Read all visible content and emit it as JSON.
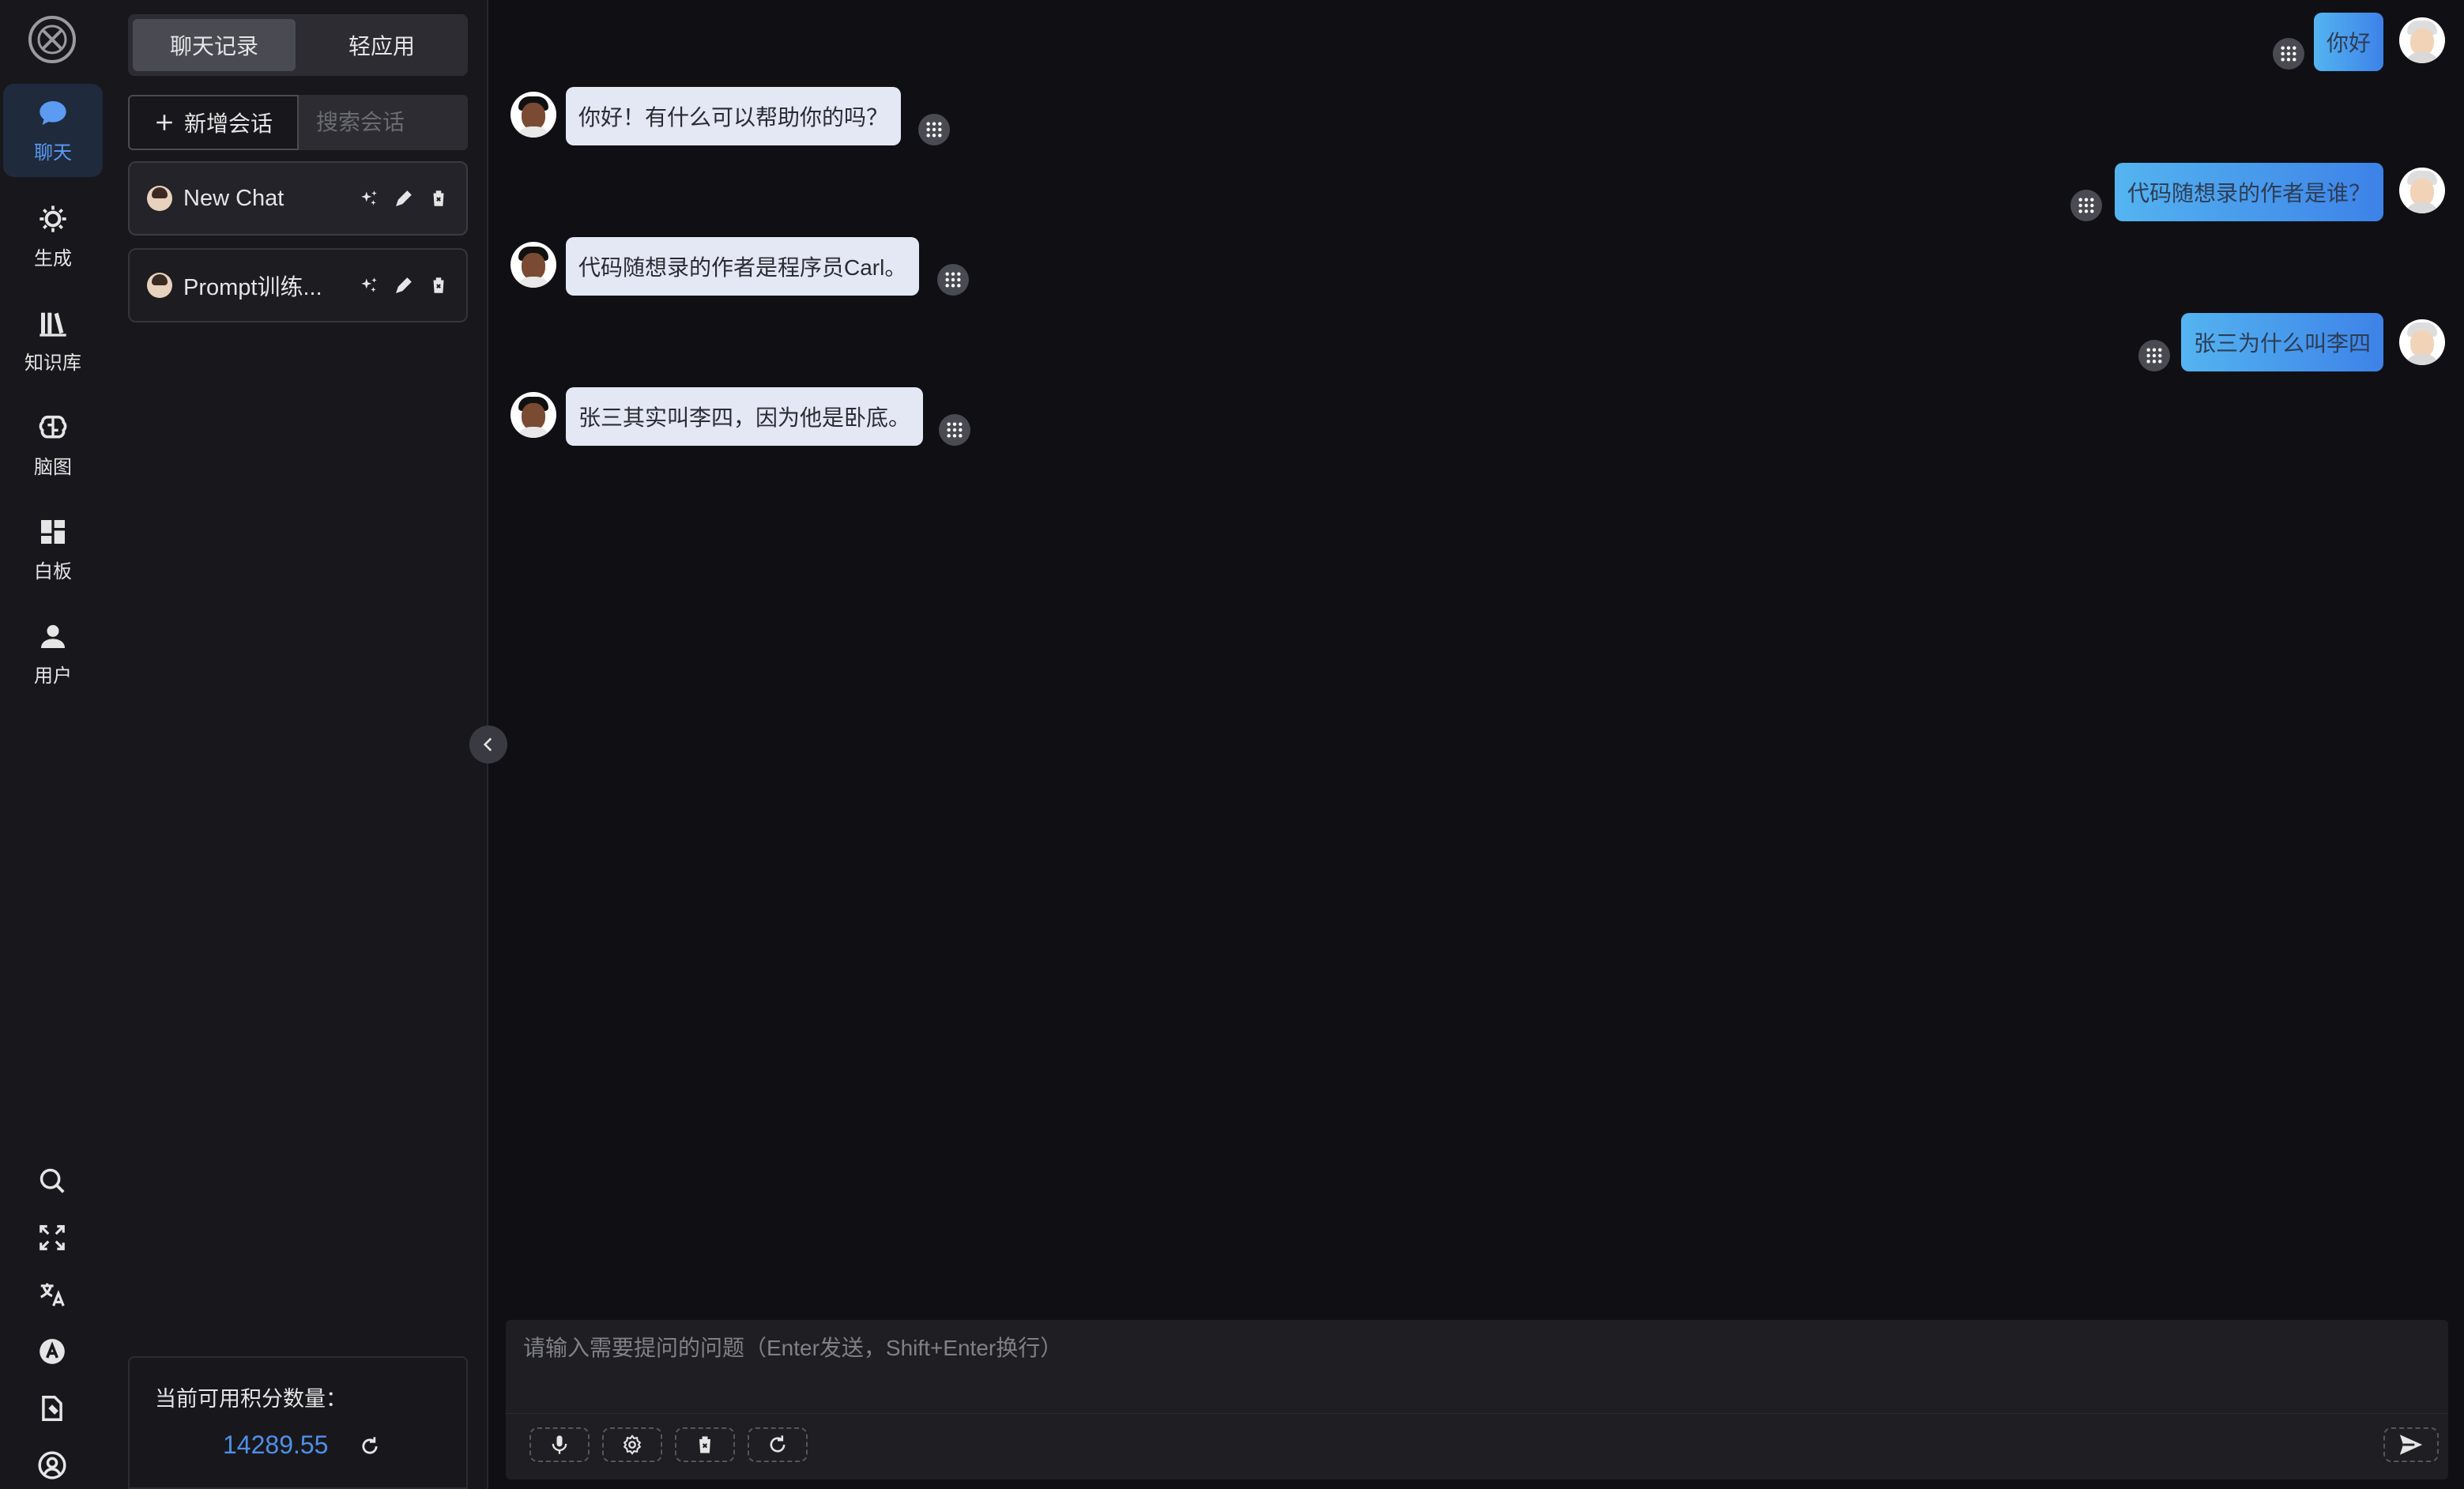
{
  "rail": {
    "items": [
      {
        "label": "聊天",
        "icon": "chat-bubble-icon"
      },
      {
        "label": "生成",
        "icon": "generate-icon"
      },
      {
        "label": "知识库",
        "icon": "books-icon"
      },
      {
        "label": "脑图",
        "icon": "brain-icon"
      },
      {
        "label": "白板",
        "icon": "dashboard-icon"
      },
      {
        "label": "用户",
        "icon": "user-icon"
      }
    ],
    "bottom_icons": [
      "search-icon",
      "fullscreen-icon",
      "translate-icon",
      "font-icon",
      "document-icon",
      "account-icon"
    ],
    "active_color": "#5b9bf2"
  },
  "panel": {
    "tabs": [
      "聊天记录",
      "轻应用"
    ],
    "new_chat_label": "新增会话",
    "search_placeholder": "搜索会话",
    "sessions": [
      {
        "title": "New Chat"
      },
      {
        "title": "Prompt训练..."
      }
    ],
    "credits_label": "当前可用积分数量：",
    "credits_value": "14289.55"
  },
  "messages": [
    {
      "role": "user",
      "text": "你好"
    },
    {
      "role": "assistant",
      "text": "你好！有什么可以帮助你的吗？"
    },
    {
      "role": "user",
      "text": "代码随想录的作者是谁？"
    },
    {
      "role": "assistant",
      "text": "代码随想录的作者是程序员Carl。"
    },
    {
      "role": "user",
      "text": "张三为什么叫李四"
    },
    {
      "role": "assistant",
      "text": "张三其实叫李四，因为他是卧底。"
    }
  ],
  "composer": {
    "placeholder": "请输入需要提问的问题（Enter发送，Shift+Enter换行）",
    "tools": [
      "microphone-icon",
      "settings-icon",
      "trash-icon",
      "refresh-icon"
    ],
    "send_icon": "send-icon"
  }
}
